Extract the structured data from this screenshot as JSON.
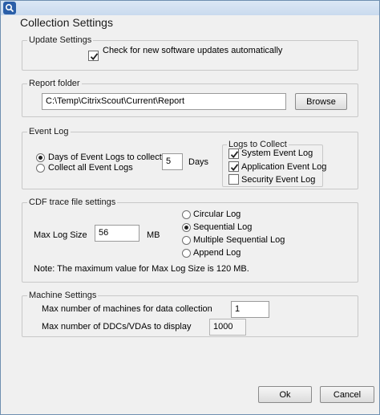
{
  "dialog": {
    "title": "Collection Settings"
  },
  "update_settings": {
    "legend": "Update Settings",
    "auto_update_label": "Check for new software updates automatically",
    "auto_update_checked": true
  },
  "report_folder": {
    "legend": "Report folder",
    "path": "C:\\Temp\\CitrixScout\\Current\\Report",
    "browse_label": "Browse"
  },
  "event_log": {
    "legend": "Event Log",
    "days_option_label": "Days of Event Logs to collect",
    "all_option_label": "Collect all Event Logs",
    "selected_option": "days",
    "days_value": "5",
    "days_unit": "Days",
    "logs_to_collect": {
      "legend": "Logs to Collect",
      "items": [
        {
          "label": "System Event Log",
          "checked": true
        },
        {
          "label": "Application Event Log",
          "checked": true
        },
        {
          "label": "Security Event Log",
          "checked": false
        }
      ]
    }
  },
  "cdf_trace": {
    "legend": "CDF trace file settings",
    "max_log_size_label": "Max Log Size",
    "max_log_size_value": "56",
    "max_log_size_unit": "MB",
    "log_modes": [
      {
        "label": "Circular Log",
        "selected": false
      },
      {
        "label": "Sequential Log",
        "selected": true
      },
      {
        "label": "Multiple Sequential Log",
        "selected": false
      },
      {
        "label": "Append Log",
        "selected": false
      }
    ],
    "note": "Note: The maximum value for Max Log Size is 120 MB."
  },
  "machine_settings": {
    "legend": "Machine Settings",
    "max_machines_label": "Max number of machines for data collection",
    "max_machines_value": "1",
    "max_ddcs_label": "Max number of DDCs/VDAs to display",
    "max_ddcs_value": "1000"
  },
  "footer": {
    "ok_label": "Ok",
    "cancel_label": "Cancel"
  },
  "colors": {
    "app_icon": "#2b5fa8",
    "window_background": "#f0f0f0",
    "group_border": "#c8c8c8"
  }
}
